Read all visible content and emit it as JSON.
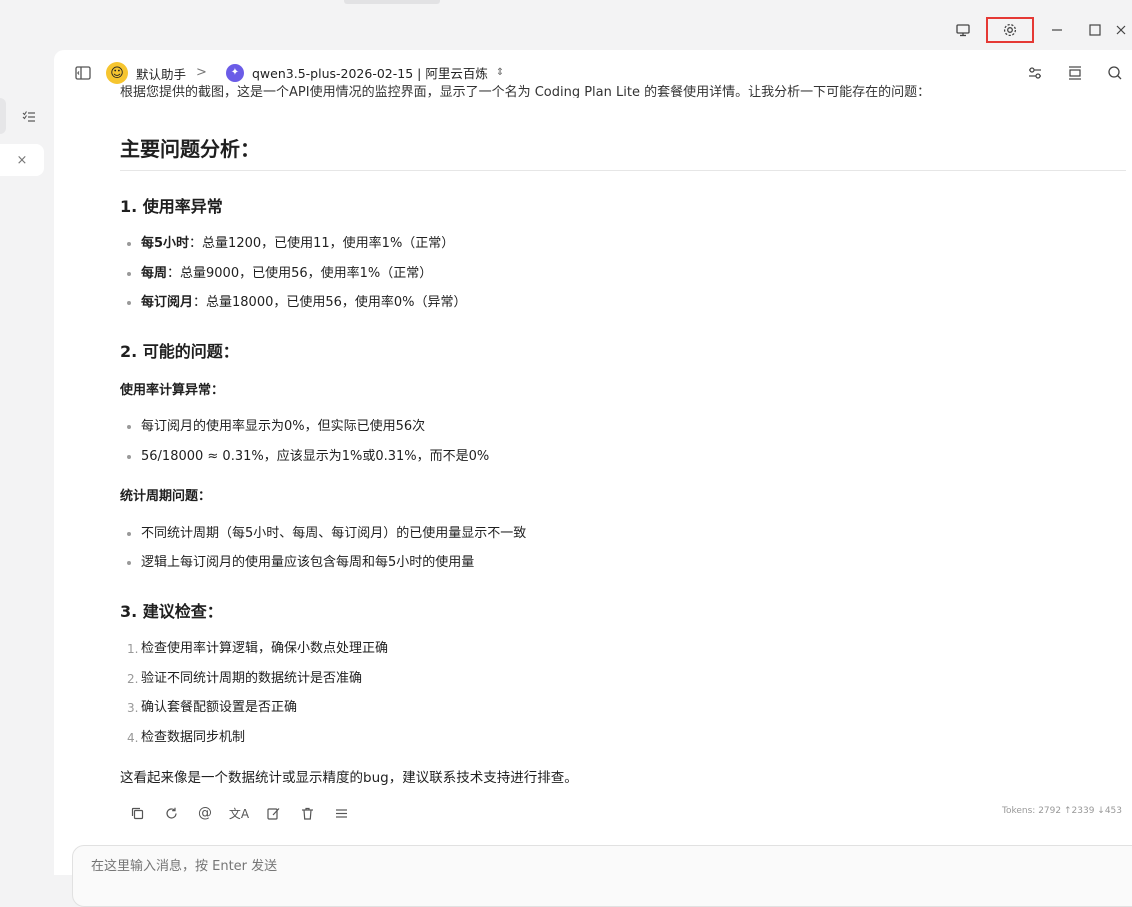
{
  "window": {
    "controls": [
      "monitor-icon",
      "gear-icon",
      "minimize-icon",
      "maximize-icon",
      "close-icon"
    ],
    "highlight_color": "#e53935"
  },
  "sidebar": {
    "items": [
      {
        "icon": "list-check-icon"
      },
      {
        "icon": "close-icon",
        "label": "×"
      }
    ]
  },
  "header": {
    "assistant_name": "默认助手",
    "separator": ">",
    "model_name": "qwen3.5-plus-2026-02-15 | 阿里云百炼",
    "right_icons": [
      "sliders-icon",
      "expand-icon",
      "search-icon"
    ]
  },
  "message": {
    "intro_line": "根据您提供的截图，这是一个API使用情况的监控界面，显示了一个名为 Coding Plan Lite 的套餐使用详情。让我分析一下可能存在的问题：",
    "heading": "主要问题分析：",
    "sections": [
      {
        "title": "1. 使用率异常",
        "items": [
          {
            "bold": "每5小时",
            "text": "：总量1200，已使用11，使用率1%（正常）"
          },
          {
            "bold": "每周",
            "text": "：总量9000，已使用56，使用率1%（正常）"
          },
          {
            "bold": "每订阅月",
            "text": "：总量18000，已使用56，使用率0%（异常）"
          }
        ]
      },
      {
        "title": "2. 可能的问题：",
        "groups": [
          {
            "subtitle": "使用率计算异常：",
            "items": [
              "每订阅月的使用率显示为0%，但实际已使用56次",
              "56/18000 ≈ 0.31%，应该显示为1%或0.31%，而不是0%"
            ]
          },
          {
            "subtitle": "统计周期问题：",
            "items": [
              "不同统计周期（每5小时、每周、每订阅月）的已使用量显示不一致",
              "逻辑上每订阅月的使用量应该包含每周和每5小时的使用量"
            ]
          }
        ]
      },
      {
        "title": "3. 建议检查：",
        "ordered": [
          {
            "num": "1.",
            "text": "检查使用率计算逻辑，确保小数点处理正确"
          },
          {
            "num": "2.",
            "text": "验证不同统计周期的数据统计是否准确"
          },
          {
            "num": "3.",
            "text": "确认套餐配额设置是否正确"
          },
          {
            "num": "4.",
            "text": "检查数据同步机制"
          }
        ]
      }
    ],
    "conclusion": "这看起来像是一个数据统计或显示精度的bug，建议联系技术支持进行排查。",
    "tokens": "Tokens: 2792 ↑2339 ↓453",
    "action_icons": [
      "copy-icon",
      "refresh-icon",
      "mention-icon",
      "translate-icon",
      "edit-icon",
      "delete-icon",
      "menu-icon"
    ]
  },
  "composer": {
    "placeholder": "在这里输入消息，按 Enter 发送"
  }
}
